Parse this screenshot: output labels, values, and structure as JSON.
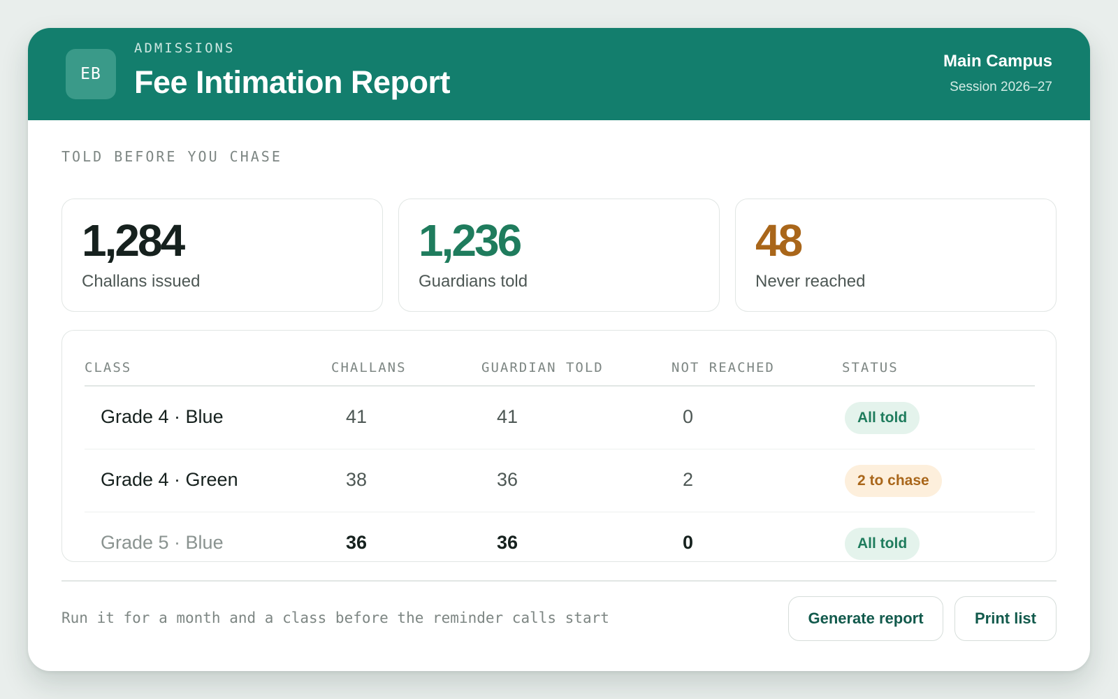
{
  "header": {
    "logo_initials": "EB",
    "eyebrow": "ADMISSIONS",
    "title": "Fee Intimation Report",
    "campus": "Main Campus",
    "session": "Session 2026–27"
  },
  "section_label": "TOLD BEFORE YOU CHASE",
  "stats": [
    {
      "value": "1,284",
      "label": "Challans issued",
      "color": "#16211e"
    },
    {
      "value": "1,236",
      "label": "Guardians told",
      "color": "#1f7c5d"
    },
    {
      "value": "48",
      "label": "Never reached",
      "color": "#a9661a"
    }
  ],
  "table": {
    "headers": {
      "class": "CLASS",
      "challans": "CHALLANS",
      "guardian_told": "GUARDIAN TOLD",
      "not_reached": "NOT REACHED",
      "status": "STATUS"
    },
    "rows": [
      {
        "class": "Grade 4 · Blue",
        "challans": "41",
        "guardian_told": "41",
        "not_reached": "0",
        "status": "All told",
        "status_kind": "ok"
      },
      {
        "class": "Grade 4 · Green",
        "challans": "38",
        "guardian_told": "36",
        "not_reached": "2",
        "status": "2 to chase",
        "status_kind": "warn"
      },
      {
        "class": "Grade 5 · Blue",
        "challans": "36",
        "guardian_told": "36",
        "not_reached": "0",
        "status": "All told",
        "status_kind": "ok"
      }
    ]
  },
  "footer": {
    "note": "Run it for a month and a class before the reminder calls start",
    "generate_label": "Generate report",
    "print_label": "Print list"
  },
  "colors": {
    "brand": "#137e6d",
    "ok": "#1f7c5d",
    "warn": "#a9661a"
  }
}
